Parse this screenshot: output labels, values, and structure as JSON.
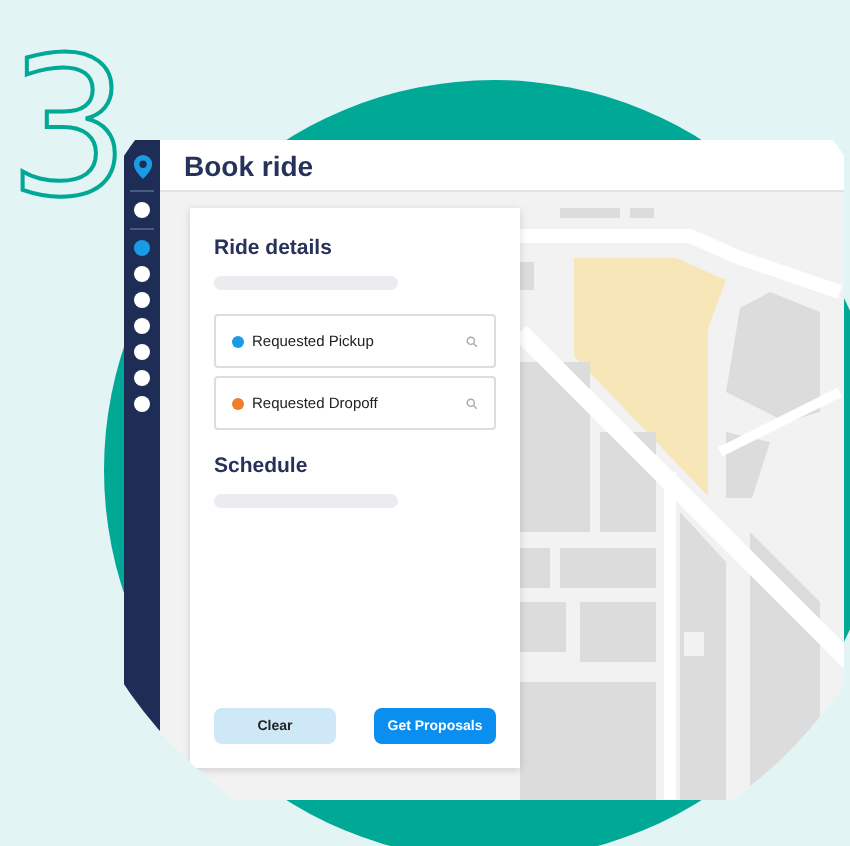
{
  "step_number": "3",
  "window": {
    "title": "Book ride"
  },
  "sidebar": {
    "top_items": [
      {
        "selected": false
      }
    ],
    "items": [
      {
        "selected": true
      },
      {
        "selected": false
      },
      {
        "selected": false
      },
      {
        "selected": false
      },
      {
        "selected": false
      },
      {
        "selected": false
      },
      {
        "selected": false
      }
    ]
  },
  "panel": {
    "sections": [
      {
        "title": "Ride details",
        "fields": [
          {
            "label": "Requested Pickup",
            "color": "#1a9be6"
          },
          {
            "label": "Requested Dropoff",
            "color": "#f07c2c"
          }
        ]
      },
      {
        "title": "Schedule"
      }
    ],
    "buttons": [
      {
        "label": "Clear",
        "kind": "secondary"
      },
      {
        "label": "Get Proposals",
        "kind": "primary"
      }
    ]
  }
}
